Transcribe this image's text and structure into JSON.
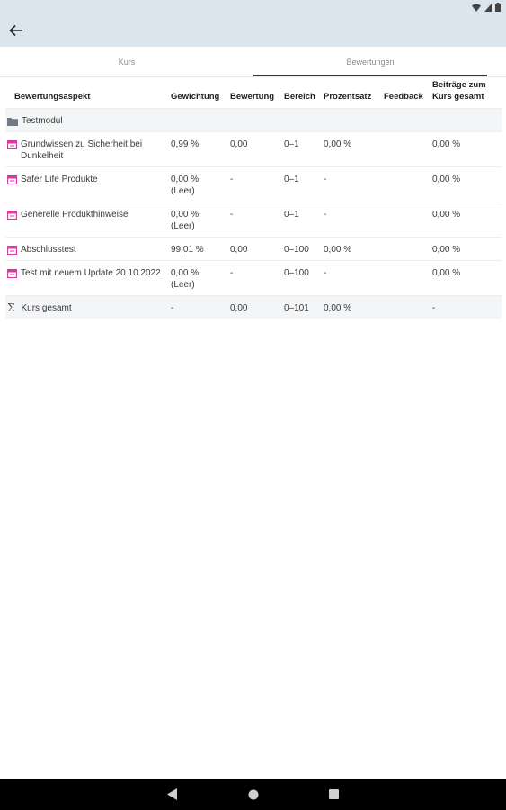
{
  "colors": {
    "appbar_bg": "#dbe5ee",
    "quiz_icon": "#d63a9a",
    "row_shade": "#f3f5f7"
  },
  "icons": {
    "back": "arrow-left-icon",
    "quiz": "quiz-icon",
    "folder": "folder-icon",
    "sigma": "sigma-icon"
  },
  "tabs": [
    {
      "label": "Kurs",
      "active": false
    },
    {
      "label": "Bewertungen",
      "active": true
    }
  ],
  "table": {
    "headers": {
      "aspect": "Bewertungsaspekt",
      "weight": "Gewichtung",
      "grade": "Bewertung",
      "range": "Bereich",
      "percent": "Prozentsatz",
      "feedback": "Feedback",
      "contrib": "Beiträge zum Kurs gesamt"
    },
    "category": "Testmodul",
    "rows": [
      {
        "name": "Grundwissen zu Sicherheit bei Dunkelheit",
        "weight": "0,99 %",
        "weight_note": "",
        "grade": "0,00",
        "range": "0–1",
        "percent": "0,00 %",
        "feedback": "",
        "contrib": "0,00 %"
      },
      {
        "name": "Safer Life Produkte",
        "weight": "0,00 %",
        "weight_note": "(Leer)",
        "grade": "-",
        "range": "0–1",
        "percent": "-",
        "feedback": "",
        "contrib": "0,00 %"
      },
      {
        "name": "Generelle Produkthinweise",
        "weight": "0,00 %",
        "weight_note": "(Leer)",
        "grade": "-",
        "range": "0–1",
        "percent": "-",
        "feedback": "",
        "contrib": "0,00 %"
      },
      {
        "name": "Abschlusstest",
        "weight": "99,01 %",
        "weight_note": "",
        "grade": "0,00",
        "range": "0–100",
        "percent": "0,00 %",
        "feedback": "",
        "contrib": "0,00 %"
      },
      {
        "name": "Test mit neuem Update 20.10.2022",
        "weight": "0,00 %",
        "weight_note": "(Leer)",
        "grade": "-",
        "range": "0–100",
        "percent": "-",
        "feedback": "",
        "contrib": "0,00 %"
      }
    ],
    "total": {
      "name": "Kurs gesamt",
      "weight": "-",
      "grade": "0,00",
      "range": "0–101",
      "percent": "0,00 %",
      "feedback": "",
      "contrib": "-"
    }
  }
}
